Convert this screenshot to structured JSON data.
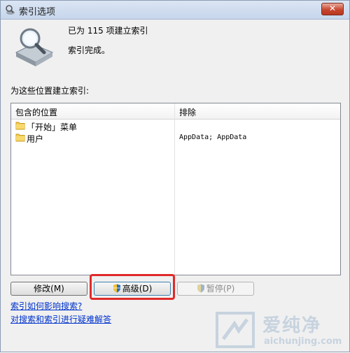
{
  "window": {
    "title": "索引选项",
    "close_label": "✕"
  },
  "status": {
    "indexed_count_text": "已为 115 项建立索引",
    "state_text": "索引完成。"
  },
  "locations": {
    "section_label": "为这些位置建立索引:",
    "columns": [
      "包含的位置",
      "排除"
    ],
    "rows": [
      {
        "name": "「开始」菜单",
        "exclude": "",
        "icon": "folder-icon"
      },
      {
        "name": "用户",
        "exclude": "AppData; AppData",
        "icon": "folder-icon"
      }
    ]
  },
  "buttons": {
    "modify": "修改(M)",
    "advanced": "高级(D)",
    "pause": "暂停(P)"
  },
  "links": {
    "search_impact": "索引如何影响搜索?",
    "troubleshoot": "对搜索和索引进行疑难解答"
  },
  "watermark": {
    "brand_cn": "爱纯净",
    "url": "aichunjing.com"
  },
  "colors": {
    "highlight": "#e02a2a",
    "link": "#0033cc",
    "close": "#c8462f"
  }
}
